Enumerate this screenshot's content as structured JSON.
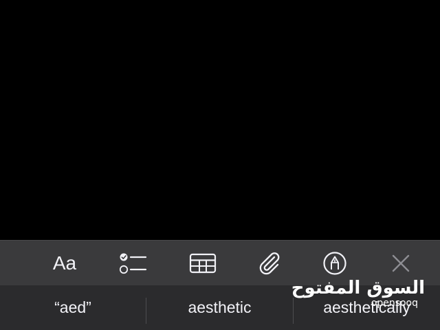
{
  "toolbar": {
    "format_label": "Aa",
    "icons": {
      "format": "text-format-icon",
      "checklist": "checklist-icon",
      "table": "table-icon",
      "attachment": "paperclip-icon",
      "markup": "pen-markup-icon",
      "close": "close-icon"
    }
  },
  "suggestions": [
    "“aed”",
    "aesthetic",
    "aesthetically"
  ],
  "watermark": {
    "arabic": "السوق المفتوح",
    "latin": "opensooq"
  },
  "colors": {
    "background": "#000000",
    "toolbar": "#3a3a3c",
    "suggestion_bar": "#2b2b2d",
    "icon": "#f2f2f7",
    "close_icon": "#8e8e93"
  }
}
